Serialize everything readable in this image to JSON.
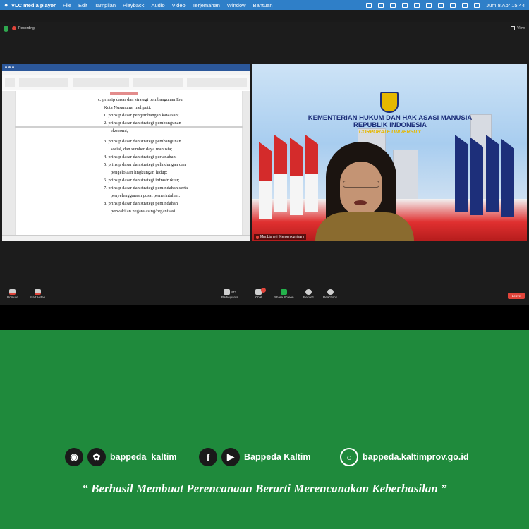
{
  "menubar": {
    "app": "VLC media player",
    "items": [
      "File",
      "Edit",
      "Tampilan",
      "Playback",
      "Audio",
      "Video",
      "Terjemahan",
      "Window",
      "Bantuan"
    ],
    "datetime": "Jum 8 Apr  15:44"
  },
  "zoom": {
    "recording_label": "Recording",
    "view_label": "View",
    "document_text": [
      "c.  prinsip dasar dan strategi pembangunan Ibu",
      "Kota Nusantara, meliputi:",
      "1.  prinsip dasar pengembangan kawasan;",
      "2.  prinsip   dasar   dan   strategi   pembangunan",
      "ekonomi;",
      "3.  prinsip   dasar   dan   strategi   pembangunan",
      "sosial, dan sumber daya manusia;",
      "4.  prinsip dasar dan strategi pertanahan;",
      "5.  prinsip dasar dan strategi pelindungan dan",
      "pengelolaan lingkungan hidup;",
      "6.  prinsip dasar dan strategi infrastruktur;",
      "7.  prinsip dasar dan strategi pemindahan serta",
      "penyelenggaraan pusat pemerintahan;",
      "8.  prinsip   dasar   dan   strategi   pemindahan",
      "perwakilan        negara        asing/organisasi"
    ],
    "ministry": {
      "line1": "KEMENTERIAN HUKUM DAN HAK ASASI MANUSIA",
      "line2": "REPUBLIK INDONESIA",
      "line3": "CORPORATE UNIVERSITY"
    },
    "participant_name": "Mm.Lisheri_Kemenkumham",
    "toolbar": {
      "unmute": "Unmute",
      "start_video": "Start Video",
      "participants": "Participants",
      "participants_count": "472",
      "chat": "Chat",
      "share_screen": "Share Screen",
      "record": "Record",
      "reactions": "Reactions",
      "leave": "Leave"
    }
  },
  "footer": {
    "instagram_twitter_handle": "bappeda_kaltim",
    "facebook_youtube_name": "Bappeda Kaltim",
    "website": "bappeda.kaltimprov.go.id",
    "tagline": "“ Berhasil  Membuat Perencanaan Berarti Merencanakan Keberhasilan ”"
  },
  "colors": {
    "menubar": "#2f7fc8",
    "footer_green": "#1f8a3c",
    "leave_red": "#e0443a",
    "share_green": "#23b24b"
  }
}
